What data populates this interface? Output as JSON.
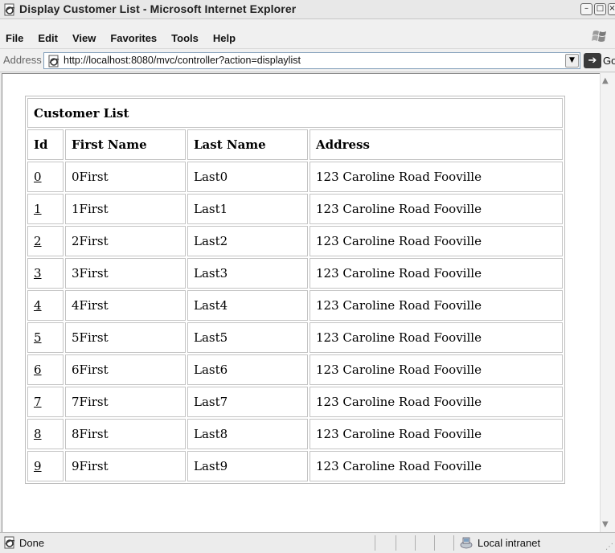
{
  "window": {
    "title": "Display Customer List - Microsoft Internet Explorer"
  },
  "menu": [
    {
      "label": "File"
    },
    {
      "label": "Edit"
    },
    {
      "label": "View"
    },
    {
      "label": "Favorites"
    },
    {
      "label": "Tools"
    },
    {
      "label": "Help"
    }
  ],
  "address": {
    "label": "Address",
    "url": "http://localhost:8080/mvc/controller?action=displaylist",
    "go_label": "Go"
  },
  "table": {
    "title": "Customer List",
    "headers": [
      "Id",
      "First Name",
      "Last Name",
      "Address"
    ],
    "rows": [
      {
        "id": "0",
        "first": "0First",
        "last": "Last0",
        "address": "123 Caroline Road Fooville"
      },
      {
        "id": "1",
        "first": "1First",
        "last": "Last1",
        "address": "123 Caroline Road Fooville"
      },
      {
        "id": "2",
        "first": "2First",
        "last": "Last2",
        "address": "123 Caroline Road Fooville"
      },
      {
        "id": "3",
        "first": "3First",
        "last": "Last3",
        "address": "123 Caroline Road Fooville"
      },
      {
        "id": "4",
        "first": "4First",
        "last": "Last4",
        "address": "123 Caroline Road Fooville"
      },
      {
        "id": "5",
        "first": "5First",
        "last": "Last5",
        "address": "123 Caroline Road Fooville"
      },
      {
        "id": "6",
        "first": "6First",
        "last": "Last6",
        "address": "123 Caroline Road Fooville"
      },
      {
        "id": "7",
        "first": "7First",
        "last": "Last7",
        "address": "123 Caroline Road Fooville"
      },
      {
        "id": "8",
        "first": "8First",
        "last": "Last8",
        "address": "123 Caroline Road Fooville"
      },
      {
        "id": "9",
        "first": "9First",
        "last": "Last9",
        "address": "123 Caroline Road Fooville"
      }
    ]
  },
  "status": {
    "text": "Done",
    "zone": "Local intranet"
  },
  "icons": {
    "title": "ie-page-icon",
    "address": "ie-page-icon",
    "status": "ie-page-icon",
    "zone": "local-intranet-icon",
    "logo": "windows-logo-icon"
  }
}
